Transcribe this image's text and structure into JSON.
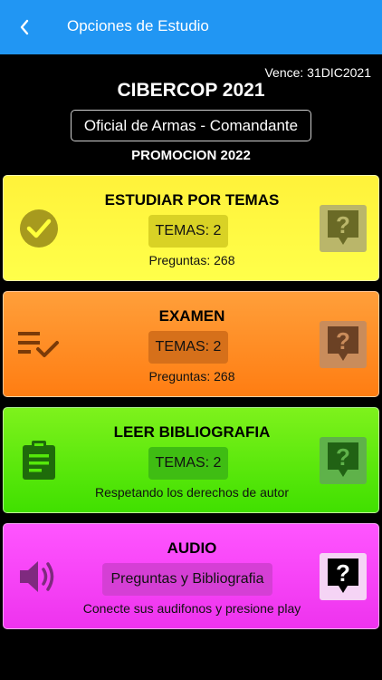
{
  "appbar": {
    "title": "Opciones de Estudio",
    "back_icon": "back-arrow-icon",
    "background": "#2196f3"
  },
  "header": {
    "expiry": "Vence: 31DIC2021",
    "brand": "CIBERCOP 2021",
    "rank": "Oficial de Armas - Comandante",
    "promotion": "PROMOCION 2022"
  },
  "cards": [
    {
      "title": "ESTUDIAR POR TEMAS",
      "chip": "TEMAS: 2",
      "subtitle": "Preguntas: 268",
      "lead_icon": "check-circle-icon",
      "help_icon": "help-question-icon",
      "color": "#ffff3a"
    },
    {
      "title": "EXAMEN",
      "chip": "TEMAS: 2",
      "subtitle": "Preguntas: 268",
      "lead_icon": "checklist-icon",
      "help_icon": "help-question-icon",
      "color": "#ff8c20"
    },
    {
      "title": "LEER BIBLIOGRAFIA",
      "chip": "TEMAS: 2",
      "subtitle": "Respetando los derechos de autor",
      "lead_icon": "clipboard-icon",
      "help_icon": "help-question-icon",
      "color": "#55e80a"
    },
    {
      "title": "AUDIO",
      "chip": "Preguntas y Bibliografia",
      "subtitle": "Conecte sus audifonos y presione play",
      "lead_icon": "speaker-icon",
      "help_icon": "help-question-icon",
      "color": "#f544f5"
    }
  ]
}
